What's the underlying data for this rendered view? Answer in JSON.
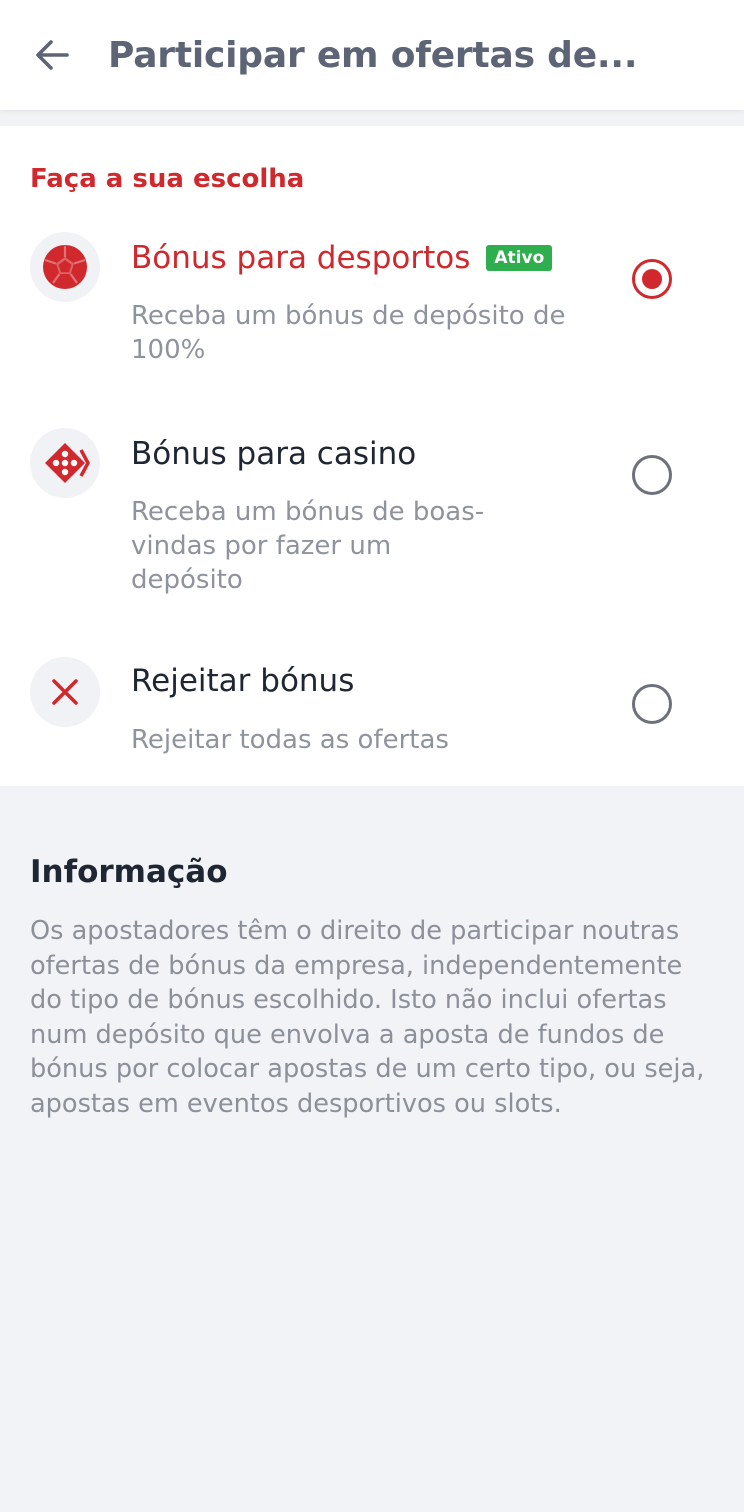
{
  "header": {
    "title": "Participar em ofertas de..."
  },
  "choices": {
    "section_title": "Faça a sua escolha",
    "options": [
      {
        "title": "Bónus para desportos",
        "badge": "Ativo",
        "description": "Receba um bónus de depósito de 100%",
        "icon": "soccer-ball-icon",
        "selected": true
      },
      {
        "title": "Bónus para casino",
        "description": "Receba um bónus de boas-vindas por fazer um depósito",
        "icon": "dice-icon",
        "selected": false
      },
      {
        "title": "Rejeitar bónus",
        "description": "Rejeitar todas as ofertas",
        "icon": "close-icon",
        "selected": false
      }
    ]
  },
  "info": {
    "title": "Informação",
    "text": "Os apostadores têm o direito de participar noutras ofertas de bónus da empresa, independentemente do tipo de bónus escolhido. Isto não inclui ofertas num depósito que envolva a aposta de fundos de bónus por colocar apostas de um certo tipo, ou seja, apostas em eventos desportivos ou slots."
  },
  "colors": {
    "accent": "#d0282c",
    "badge": "#2fae4d",
    "background": "#f1f3f6"
  }
}
